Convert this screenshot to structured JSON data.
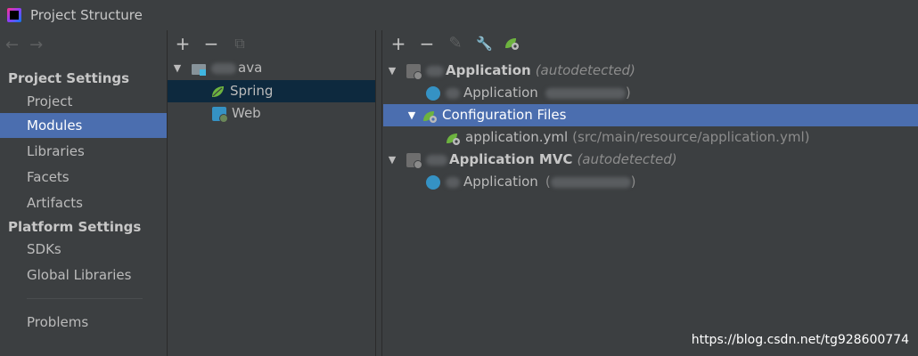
{
  "window": {
    "title": "Project Structure"
  },
  "nav": {
    "back": "←",
    "forward": "→"
  },
  "sidebar": {
    "project_settings_header": "Project Settings",
    "platform_settings_header": "Platform Settings",
    "items": [
      {
        "label": "Project"
      },
      {
        "label": "Modules"
      },
      {
        "label": "Libraries"
      },
      {
        "label": "Facets"
      },
      {
        "label": "Artifacts"
      },
      {
        "label": "SDKs"
      },
      {
        "label": "Global Libraries"
      },
      {
        "label": "Problems"
      }
    ]
  },
  "middle": {
    "toolbar": {
      "add": "+",
      "remove": "−",
      "copy": "⧉"
    },
    "tree": [
      {
        "label": "ava"
      },
      {
        "label": "Spring"
      },
      {
        "label": "Web"
      }
    ]
  },
  "right": {
    "toolbar": {
      "add": "+",
      "remove": "−",
      "edit": "✎",
      "settings": "🔧"
    },
    "tree": [
      {
        "label": "Application",
        "suffix": "(autodetected)"
      },
      {
        "label": "Application",
        "suffix": ")"
      },
      {
        "label": "Configuration Files"
      },
      {
        "label": "application.yml",
        "suffix": "(src/main/resource/application.yml)"
      },
      {
        "label": "Application MVC",
        "suffix": "(autodetected)"
      },
      {
        "label": "Application",
        "prefix": "(",
        "suffix": ")"
      }
    ]
  },
  "watermark": "https://blog.csdn.net/tg928600774",
  "colors": {
    "selection": "#4b6eaf",
    "selection_inactive": "#0d293e",
    "background": "#3c3f41",
    "spring_green": "#6db33f"
  }
}
